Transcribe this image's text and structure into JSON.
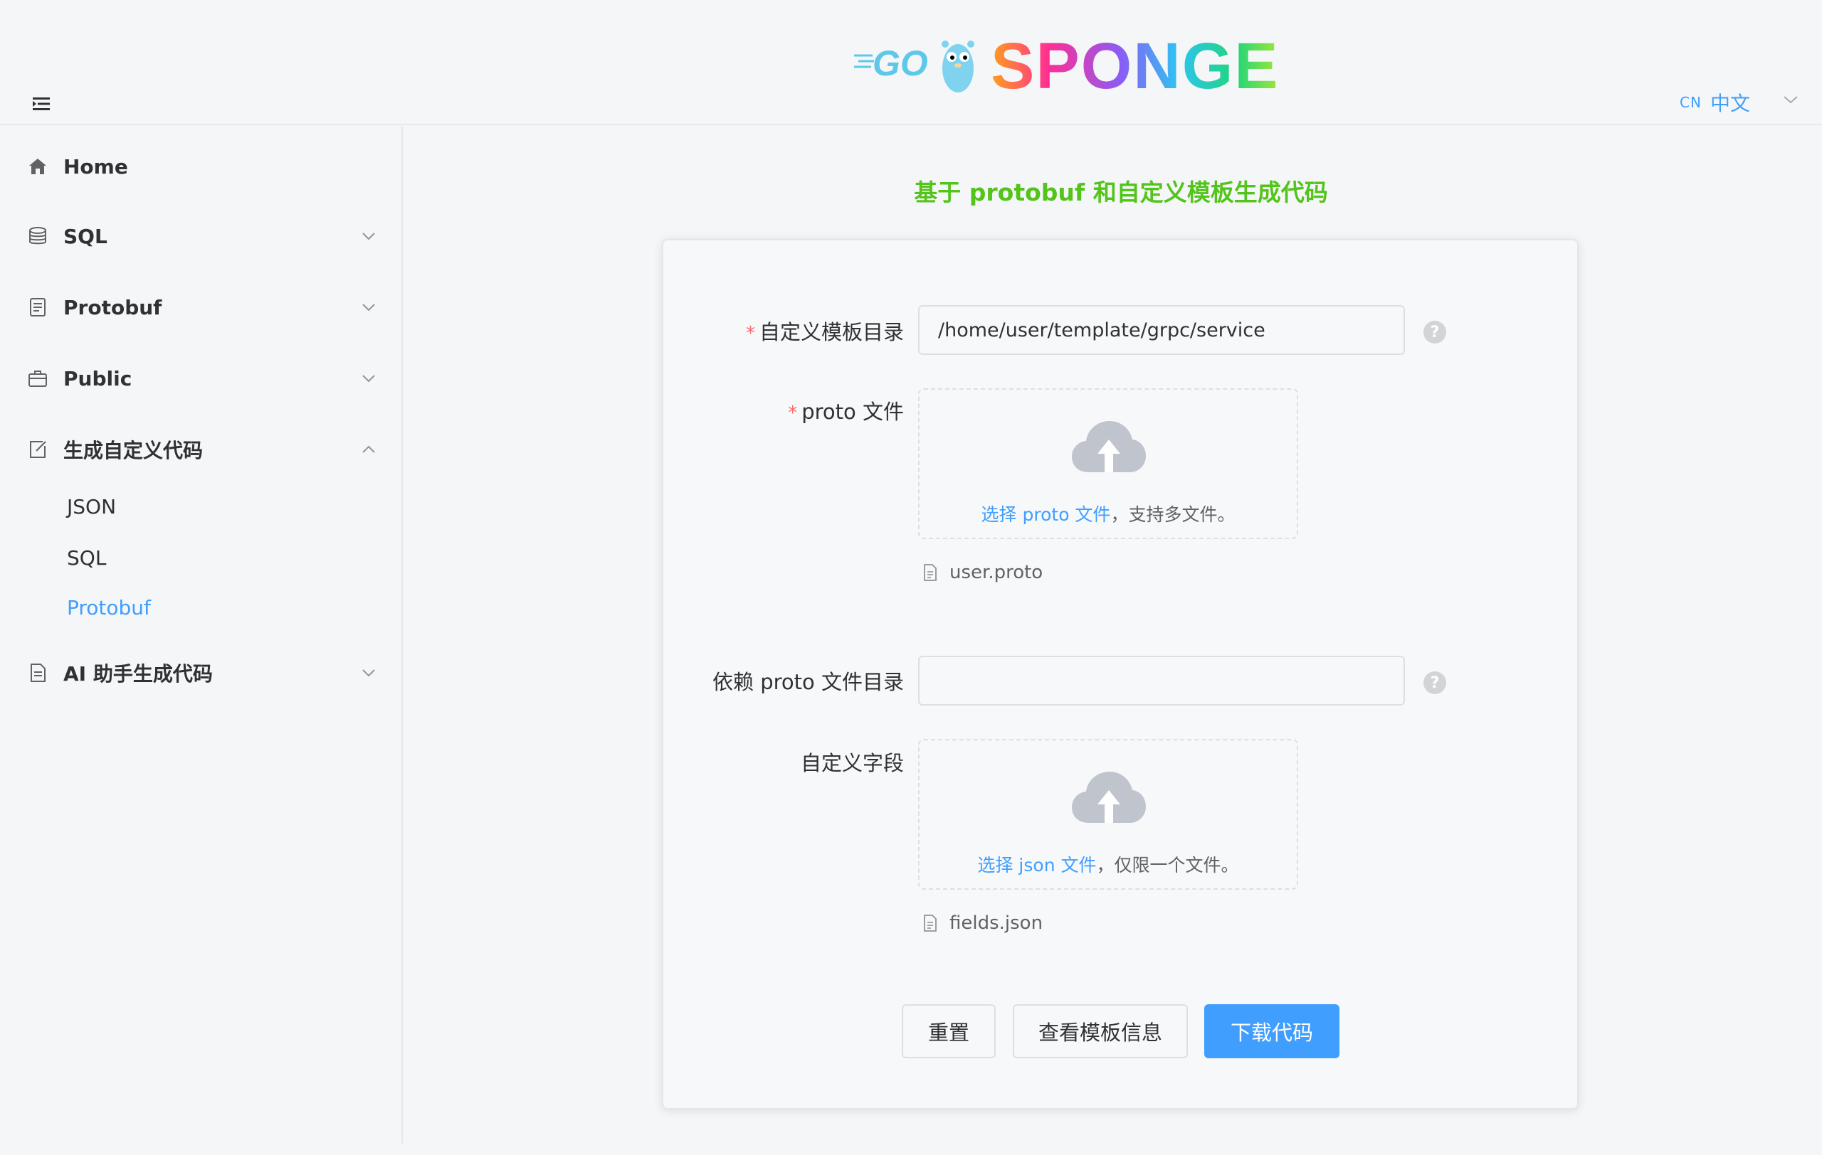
{
  "header": {
    "logo_go": "GO",
    "logo_sponge": "SPONGE",
    "lang_code": "CN",
    "lang_name": "中文"
  },
  "sidebar": {
    "items": [
      {
        "label": "Home",
        "icon": "home-icon"
      },
      {
        "label": "SQL",
        "icon": "database-icon"
      },
      {
        "label": "Protobuf",
        "icon": "document-icon"
      },
      {
        "label": "Public",
        "icon": "briefcase-icon"
      },
      {
        "label": "生成自定义代码",
        "icon": "edit-icon"
      },
      {
        "label": "AI 助手生成代码",
        "icon": "document-icon"
      }
    ],
    "sub_items": [
      "JSON",
      "SQL",
      "Protobuf"
    ],
    "active_sub": "Protobuf"
  },
  "main": {
    "title": "基于 protobuf 和自定义模板生成代码",
    "form": {
      "template_dir": {
        "label": "自定义模板目录",
        "value": "/home/user/template/grpc/service"
      },
      "proto_file": {
        "label": "proto 文件",
        "hint_link": "选择 proto 文件",
        "hint_text": "，支持多文件。",
        "file": "user.proto"
      },
      "proto_dir": {
        "label": "依赖 proto 文件目录",
        "value": ""
      },
      "custom_fields": {
        "label": "自定义字段",
        "hint_link": "选择 json 文件",
        "hint_text": "，仅限一个文件。",
        "file": "fields.json"
      },
      "required_mark": "*",
      "help_mark": "?"
    },
    "buttons": {
      "reset": "重置",
      "view_template": "查看模板信息",
      "download": "下载代码"
    }
  },
  "colors": {
    "accent": "#409eff",
    "title_green": "#52c41a",
    "required": "#f56c6c"
  }
}
